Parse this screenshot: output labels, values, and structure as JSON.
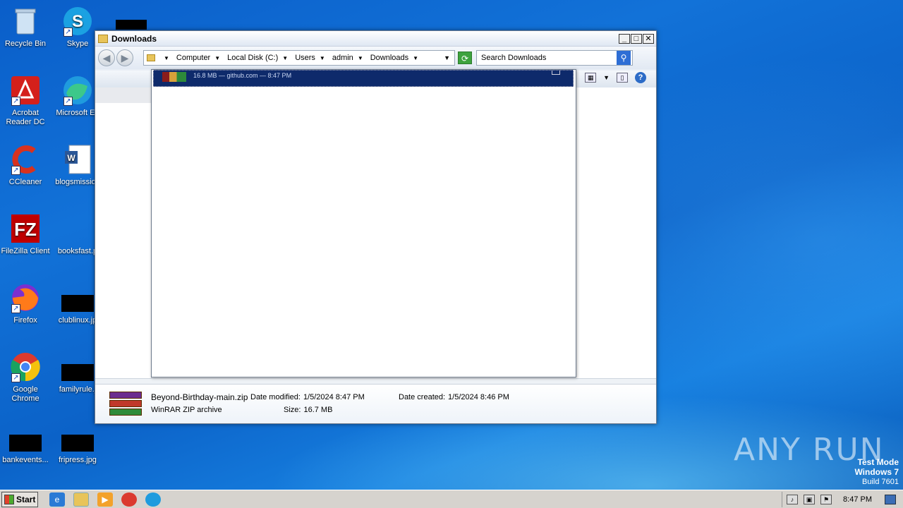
{
  "desktop": {
    "icons": [
      {
        "label": "Recycle Bin"
      },
      {
        "label": "Skype"
      },
      {
        "label": "Acrobat Reader DC"
      },
      {
        "label": "Microsoft Ed"
      },
      {
        "label": "CCleaner"
      },
      {
        "label": "blogsmission"
      },
      {
        "label": "FileZilla Client"
      },
      {
        "label": "booksfast.p"
      },
      {
        "label": "Firefox"
      },
      {
        "label": "clublinux.jp"
      },
      {
        "label": "Google Chrome"
      },
      {
        "label": "familyrule.j"
      },
      {
        "label": "bankevents..."
      },
      {
        "label": "fripress.jpg"
      }
    ]
  },
  "window": {
    "title": "Downloads",
    "breadcrumbs": [
      "Computer",
      "Local Disk (C:)",
      "Users",
      "admin",
      "Downloads"
    ],
    "search_placeholder": "Search Downloads",
    "download_popup": {
      "meta": "16.8 MB — github.com — 8:47 PM"
    },
    "details": {
      "name": "Beyond-Birthday-main.zip",
      "type": "WinRAR ZIP archive",
      "date_modified_label": "Date modified:",
      "date_modified": "1/5/2024 8:47 PM",
      "date_created_label": "Date created:",
      "date_created": "1/5/2024 8:46 PM",
      "size_label": "Size:",
      "size": "16.7 MB"
    }
  },
  "taskbar": {
    "start_label": "Start",
    "clock": "8:47 PM"
  },
  "watermark": {
    "line1": "Test Mode",
    "line2": "Windows 7",
    "line3": "Build 7601",
    "brand": "ANY RUN"
  }
}
